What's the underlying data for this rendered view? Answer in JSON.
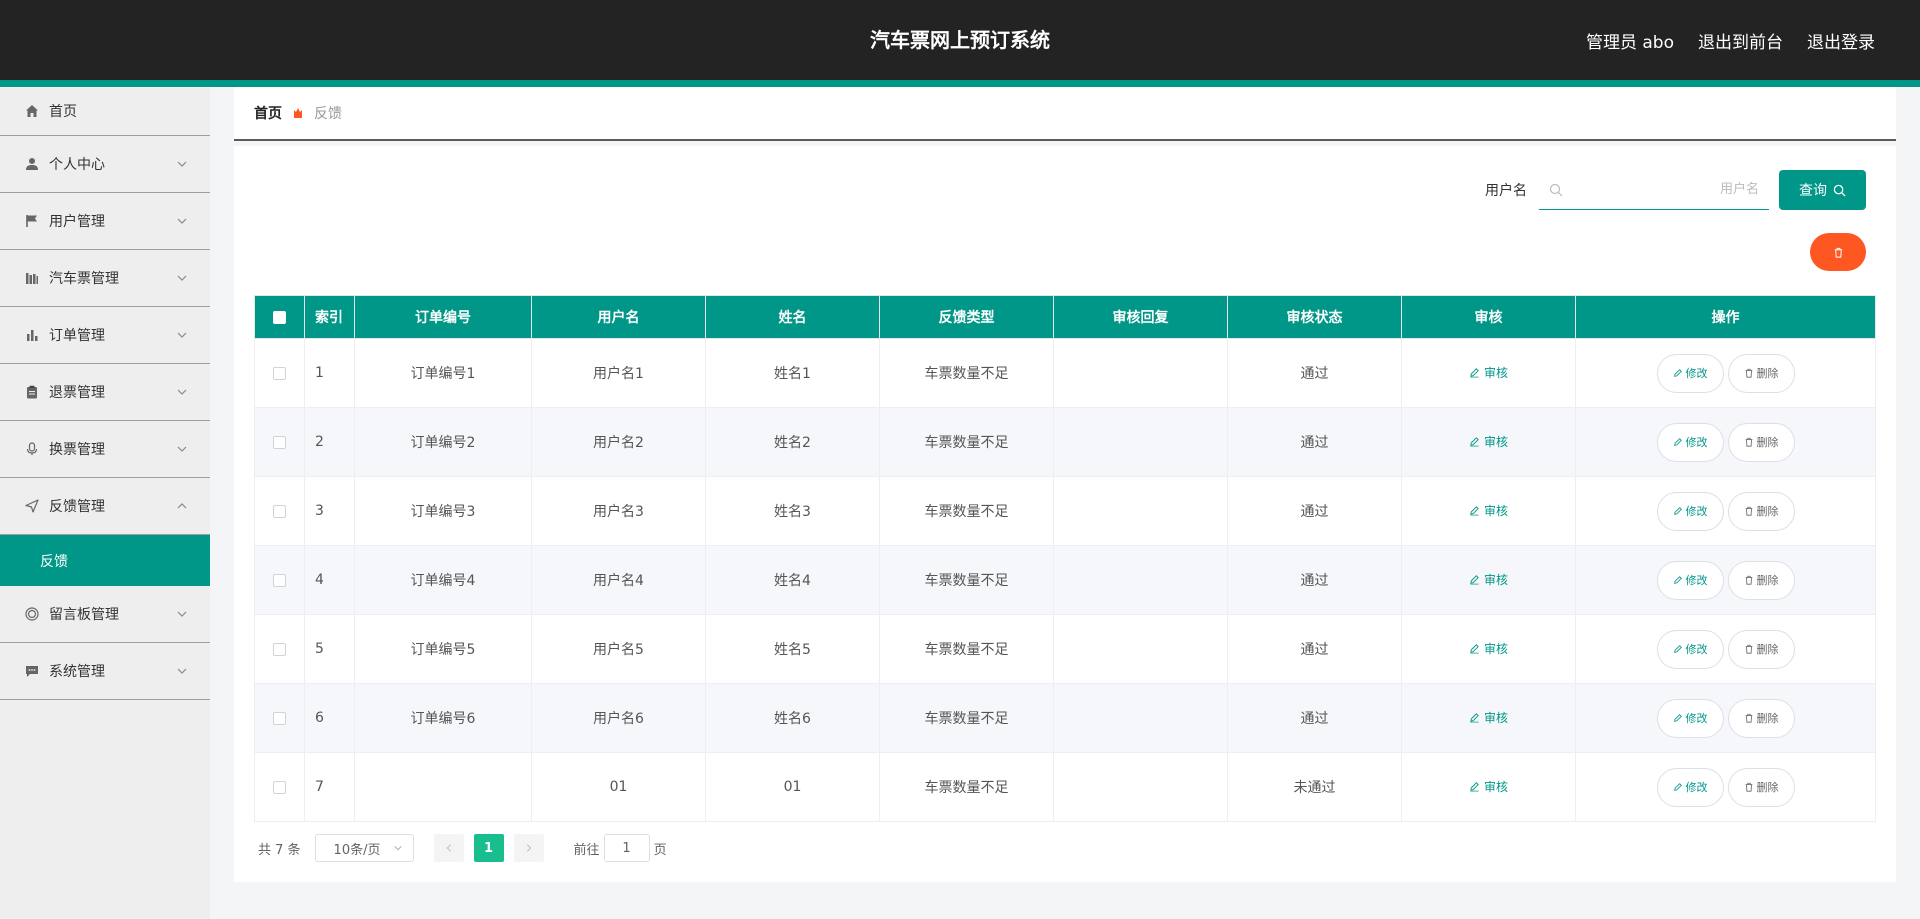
{
  "header": {
    "title": "汽车票网上预订系统",
    "admin_label": "管理员 abo",
    "to_front_label": "退出到前台",
    "logout_label": "退出登录"
  },
  "sidebar": {
    "items": [
      {
        "label": "首页",
        "icon": "home-icon"
      },
      {
        "label": "个人中心",
        "icon": "user-icon"
      },
      {
        "label": "用户管理",
        "icon": "flag-icon"
      },
      {
        "label": "汽车票管理",
        "icon": "bars-icon"
      },
      {
        "label": "订单管理",
        "icon": "chart-icon"
      },
      {
        "label": "退票管理",
        "icon": "clipboard-icon"
      },
      {
        "label": "换票管理",
        "icon": "mic-icon"
      },
      {
        "label": "反馈管理",
        "icon": "send-icon"
      },
      {
        "label": "留言板管理",
        "icon": "target-icon"
      },
      {
        "label": "系统管理",
        "icon": "message-icon"
      }
    ],
    "submenu_active": "反馈"
  },
  "breadcrumb": {
    "home": "首页",
    "current": "反馈"
  },
  "search": {
    "label": "用户名",
    "placeholder": "用户名",
    "button_label": "查询"
  },
  "table": {
    "headers": [
      "索引",
      "订单编号",
      "用户名",
      "姓名",
      "反馈类型",
      "审核回复",
      "审核状态",
      "审核",
      "操作"
    ],
    "audit_label": "审核",
    "edit_label": "修改",
    "delete_label": "删除",
    "rows": [
      {
        "index": "1",
        "order_no": "订单编号1",
        "username": "用户名1",
        "name": "姓名1",
        "type": "车票数量不足",
        "reply": "",
        "status": "通过"
      },
      {
        "index": "2",
        "order_no": "订单编号2",
        "username": "用户名2",
        "name": "姓名2",
        "type": "车票数量不足",
        "reply": "",
        "status": "通过"
      },
      {
        "index": "3",
        "order_no": "订单编号3",
        "username": "用户名3",
        "name": "姓名3",
        "type": "车票数量不足",
        "reply": "",
        "status": "通过"
      },
      {
        "index": "4",
        "order_no": "订单编号4",
        "username": "用户名4",
        "name": "姓名4",
        "type": "车票数量不足",
        "reply": "",
        "status": "通过"
      },
      {
        "index": "5",
        "order_no": "订单编号5",
        "username": "用户名5",
        "name": "姓名5",
        "type": "车票数量不足",
        "reply": "",
        "status": "通过"
      },
      {
        "index": "6",
        "order_no": "订单编号6",
        "username": "用户名6",
        "name": "姓名6",
        "type": "车票数量不足",
        "reply": "",
        "status": "通过"
      },
      {
        "index": "7",
        "order_no": "",
        "username": "01",
        "name": "01",
        "type": "车票数量不足",
        "reply": "",
        "status": "未通过"
      }
    ]
  },
  "pagination": {
    "total_label": "共 7 条",
    "page_size": "10条/页",
    "current_page": "1",
    "goto_prefix": "前往",
    "goto_value": "1",
    "goto_suffix": "页"
  },
  "colors": {
    "accent": "#009688",
    "danger": "#ff5722",
    "header_bg": "#232323"
  }
}
